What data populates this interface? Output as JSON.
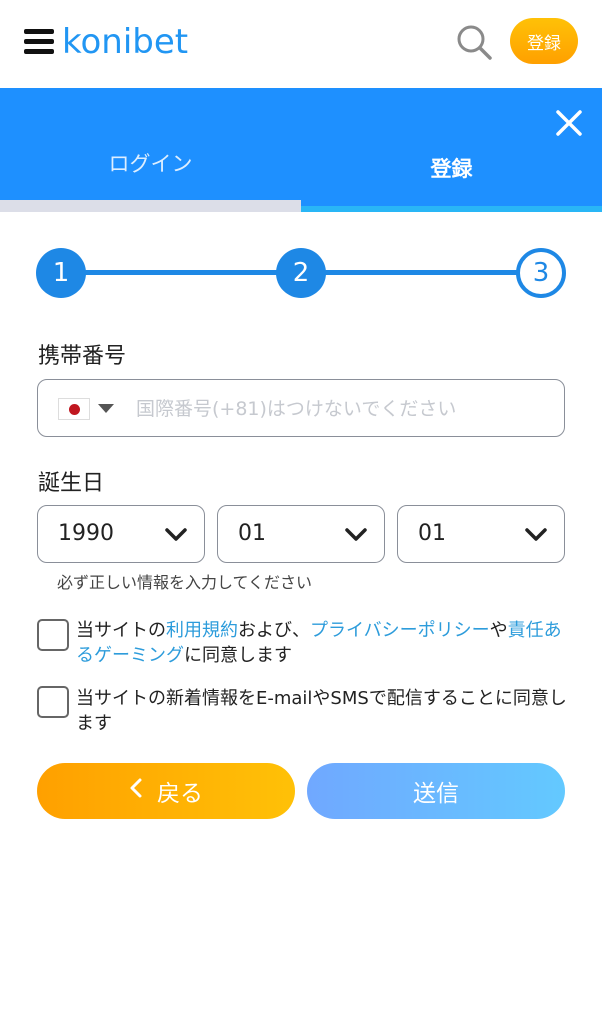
{
  "header": {
    "logo_text": "konibet",
    "register_label": "登録"
  },
  "tabs": [
    {
      "label": "ログイン",
      "active": false
    },
    {
      "label": "登録",
      "active": true
    }
  ],
  "stepper": {
    "steps": [
      "1",
      "2",
      "3"
    ],
    "current": 3
  },
  "phone": {
    "label": "携帯番号",
    "country": "jp-flag-icon",
    "placeholder": "国際番号(+81)はつけないでください",
    "value": ""
  },
  "birthday": {
    "label": "誕生日",
    "year": "1990",
    "month": "01",
    "day": "01",
    "hint": "必ず正しい情報を入力してください"
  },
  "agreements": {
    "terms": {
      "pre": "当サイトの",
      "terms_link": "利用規約",
      "mid1": "および、",
      "privacy_link": "プライバシーポリシー",
      "mid2": "や",
      "gaming_link": "責任あるゲーミング",
      "post": "に同意します",
      "checked": false
    },
    "newsletter": {
      "text": "当サイトの新着情報をE-mailやSMSで配信することに同意します",
      "checked": false
    }
  },
  "buttons": {
    "back_label": "戻る",
    "send_label": "送信"
  },
  "colors": {
    "primary_blue": "#1e90ff",
    "accent_orange": "#ffa000",
    "link_blue": "#2d9cdb"
  }
}
